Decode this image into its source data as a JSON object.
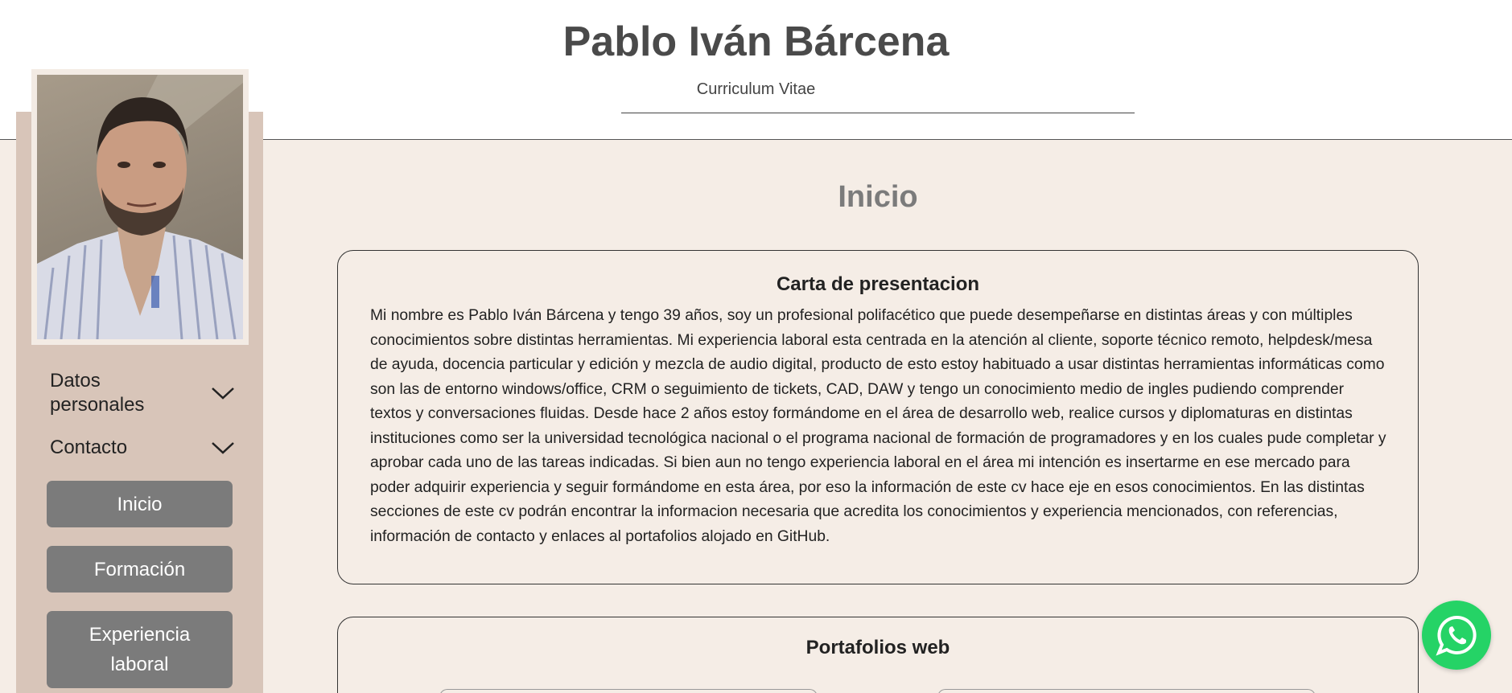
{
  "header": {
    "name": "Pablo Iván Bárcena",
    "subtitle": "Curriculum Vitae"
  },
  "sidebar": {
    "accordions": [
      {
        "label": "Datos personales",
        "icon": "chevron-down-icon"
      },
      {
        "label": "Contacto",
        "icon": "chevron-down-icon"
      }
    ],
    "nav": [
      {
        "label": "Inicio"
      },
      {
        "label": "Formación"
      },
      {
        "label": "Experiencia laboral"
      }
    ]
  },
  "main": {
    "title": "Inicio",
    "cards": [
      {
        "title": "Carta de presentacion",
        "body": "Mi nombre es Pablo Iván Bárcena y tengo 39 años, soy un profesional polifacético que puede desempeñarse en distintas áreas y con múltiples conocimientos sobre distintas herramientas. Mi experiencia laboral esta centrada en la atención al cliente, soporte técnico remoto, helpdesk/mesa de ayuda, docencia particular y edición y mezcla de audio digital, producto de esto estoy habituado a usar distintas herramientas informáticas como son las de entorno windows/office, CRM o seguimiento de tickets, CAD, DAW y tengo un conocimiento medio de ingles pudiendo comprender textos y conversaciones fluidas. Desde hace 2 años estoy formándome en el área de desarrollo web, realice cursos y diplomaturas en distintas instituciones como ser la universidad tecnológica nacional o el programa nacional de formación de programadores y en los cuales pude completar y aprobar cada uno de las tareas indicadas. Si bien aun no tengo experiencia laboral en el área mi intención es insertarme en ese mercado para poder adquirir experiencia y seguir formándome en esta área, por eso la información de este cv hace eje en esos conocimientos. En las distintas secciones de este cv podrán encontrar la informacion necesaria que acredita los conocimientos y experiencia mencionados, con referencias, información de contacto y enlaces al portafolios alojado en GitHub."
      },
      {
        "title": "Portafolios web"
      }
    ]
  },
  "fab": {
    "icon": "whatsapp-icon"
  },
  "colors": {
    "background": "#f5ede6",
    "sidebar": "#d8c5b9",
    "button": "#7b7b7b",
    "whatsapp": "#25d366"
  }
}
